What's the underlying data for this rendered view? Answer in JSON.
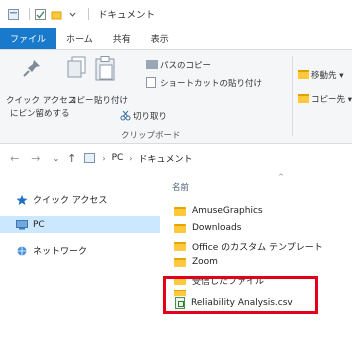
{
  "window": {
    "title": "ドキュメント"
  },
  "ribbon": {
    "tabs": [
      "ファイル",
      "ホーム",
      "共有",
      "表示"
    ],
    "pin_label_1": "クイック アクセス",
    "pin_label_2": "にピン留めする",
    "copy_label": "コピー",
    "paste_label": "貼り付け",
    "copy_path_label": "パスのコピー",
    "paste_shortcut_label": "ショートカットの貼り付け",
    "cut_label": "切り取り",
    "clipboard_group": "クリップボード",
    "move_to_label": "移動先",
    "copy_to_label": "コピー先"
  },
  "address": {
    "crumbs": [
      "PC",
      "ドキュメント"
    ]
  },
  "nav": {
    "items": [
      "クイック アクセス",
      "PC",
      "ネットワーク"
    ]
  },
  "files": {
    "column_name": "名前",
    "items": [
      "AmuseGraphics",
      "Downloads",
      "Office のカスタム テンプレート",
      "Zoom",
      "受信したファイル",
      "Reliability Analysis.csv"
    ]
  },
  "colors": {
    "file_tab": "#1979ca",
    "highlight": "#e3001b",
    "folder": "#ffc83d",
    "selection": "#cce8ff"
  }
}
